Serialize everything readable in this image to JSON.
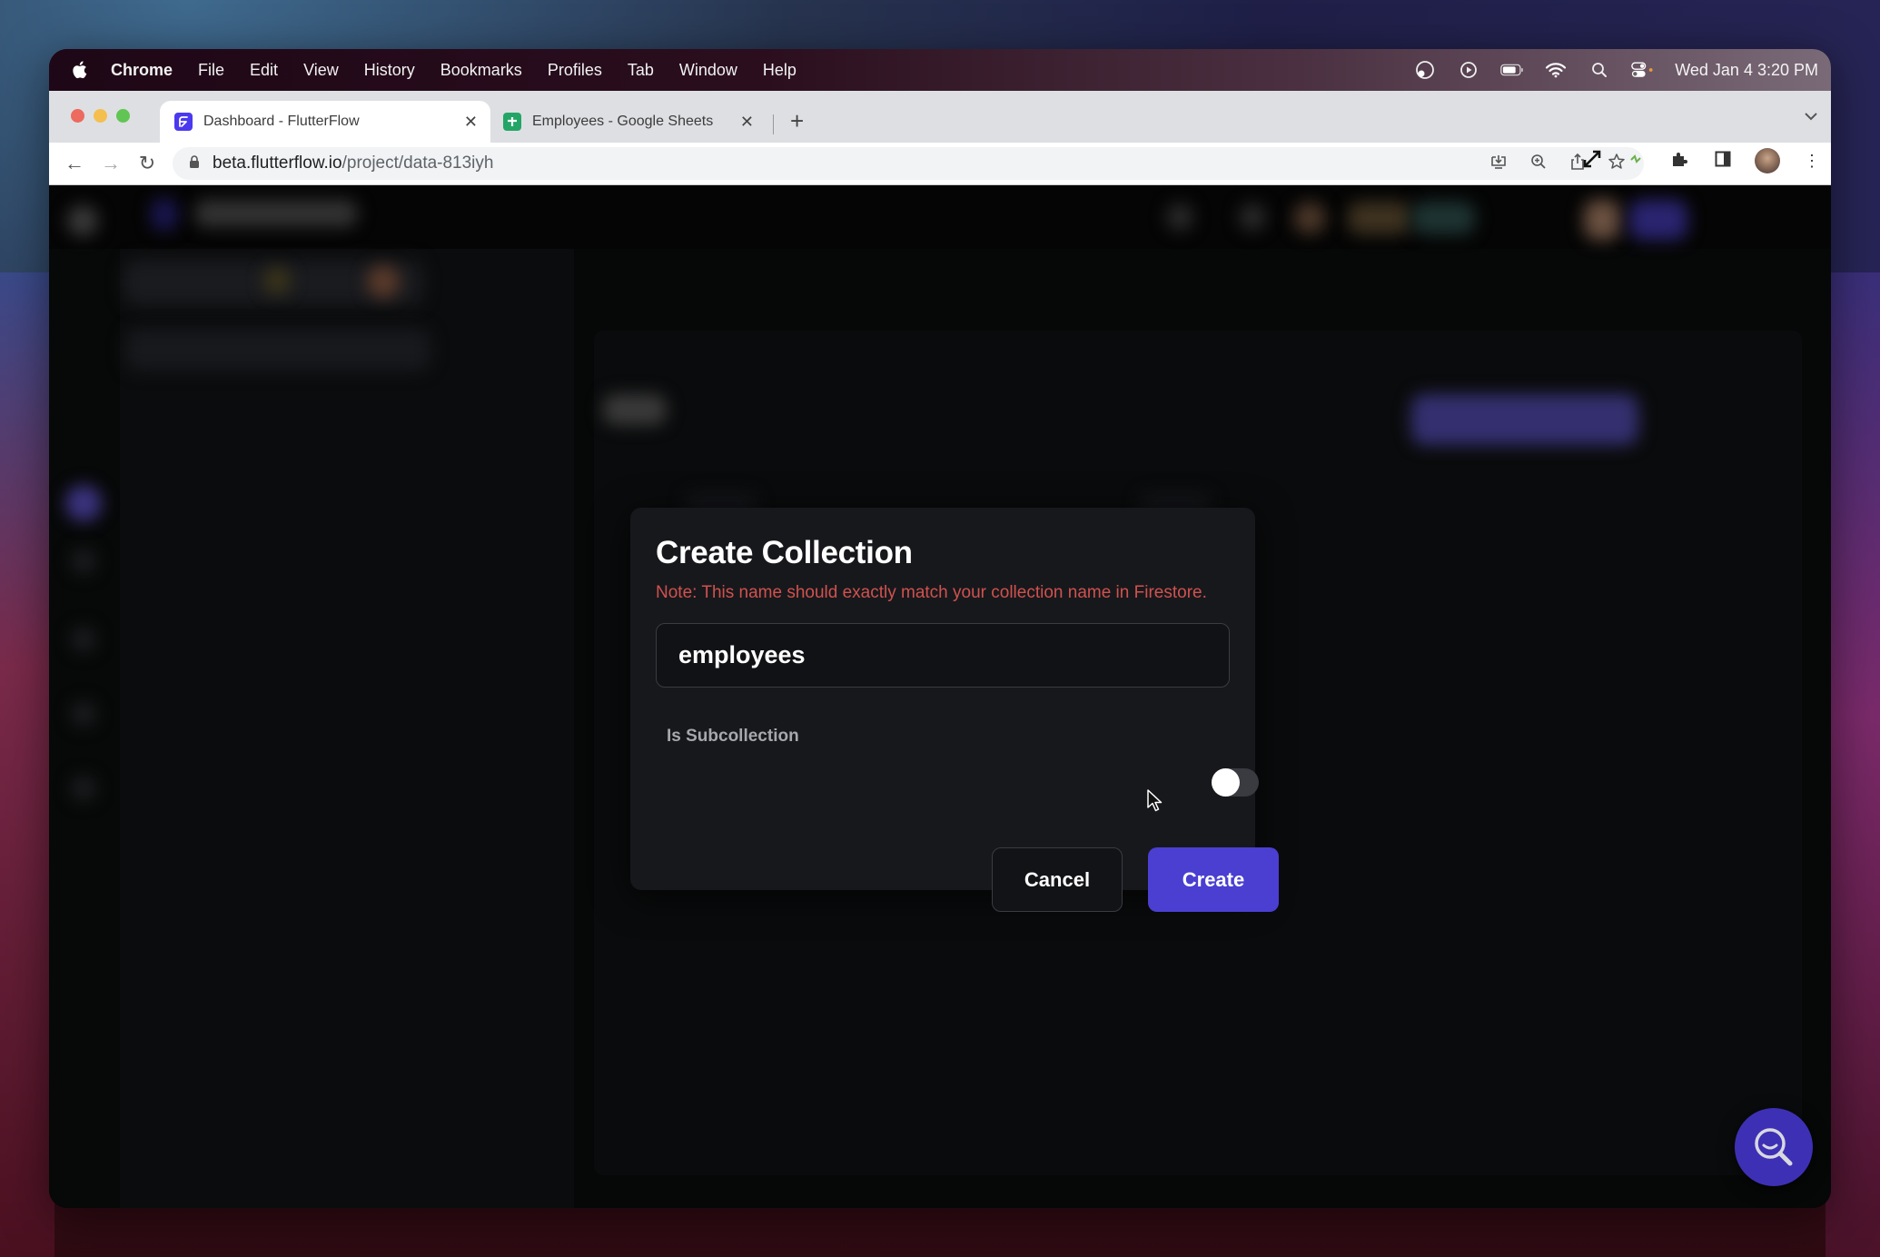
{
  "menubar": {
    "app_name": "Chrome",
    "items": [
      "File",
      "Edit",
      "View",
      "History",
      "Bookmarks",
      "Profiles",
      "Tab",
      "Window",
      "Help"
    ],
    "status_icons": [
      "creative-cloud-icon",
      "play-icon",
      "battery-icon",
      "wifi-icon",
      "spotlight-search-icon",
      "control-center-icon"
    ],
    "clock": "Wed Jan 4  3:20 PM"
  },
  "browser": {
    "tabs": [
      {
        "title": "Dashboard - FlutterFlow",
        "favicon": "flutterflow-icon",
        "active": true
      },
      {
        "title": "Employees - Google Sheets",
        "favicon": "google-sheets-icon",
        "active": false
      }
    ],
    "new_tab_label": "+",
    "address": {
      "domain": "beta.flutterflow.io",
      "path": "/project/data-813iyh"
    }
  },
  "dialog": {
    "title": "Create Collection",
    "note": "Note: This name should exactly match your collection name in Firestore.",
    "name_input_value": "employees",
    "subcollection_label": "Is Subcollection",
    "subcollection_enabled": false,
    "cancel_label": "Cancel",
    "create_label": "Create"
  },
  "colors": {
    "accent": "#4a3fd1",
    "note_red": "#d0524e",
    "dialog_bg": "#17181c",
    "fab": "#3d30b5"
  },
  "fab": {
    "icon": "search-icon"
  }
}
